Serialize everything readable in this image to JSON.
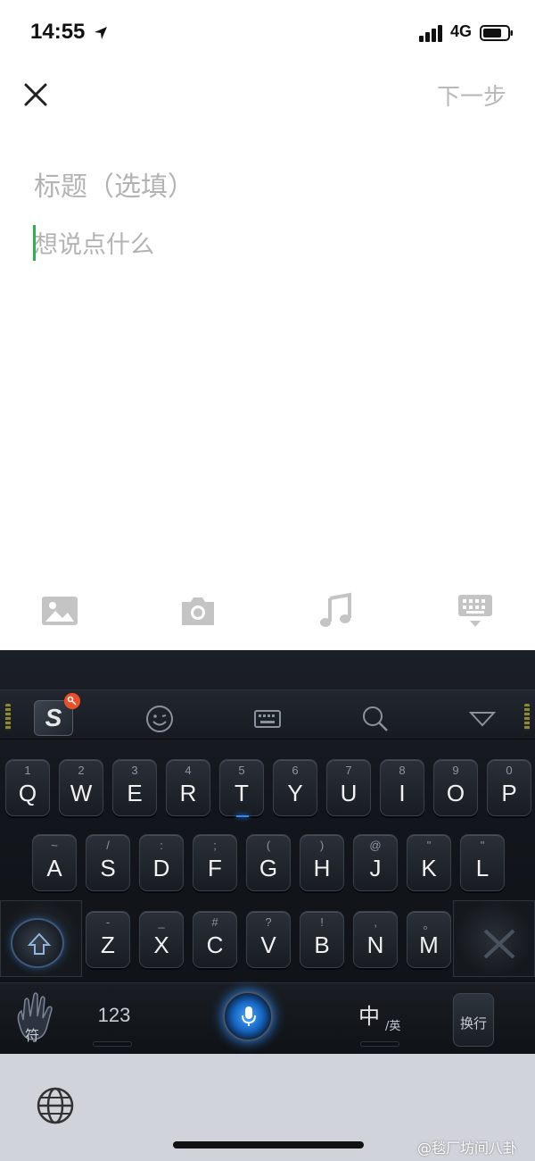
{
  "status_bar": {
    "time": "14:55",
    "network": "4G"
  },
  "nav": {
    "next_label": "下一步"
  },
  "editor": {
    "title_placeholder": "标题（选填）",
    "body_placeholder": "想说点什么"
  },
  "media_toolbar": {
    "icons": [
      "image-icon",
      "camera-icon",
      "music-icon",
      "keyboard-hide-icon"
    ]
  },
  "keyboard": {
    "theme_colors": {
      "accent": "#2f8cff",
      "key_bg": "#1f242b",
      "caret": "#2bb24c"
    },
    "row1": [
      {
        "main": "Q",
        "sub": "1"
      },
      {
        "main": "W",
        "sub": "2"
      },
      {
        "main": "E",
        "sub": "3"
      },
      {
        "main": "R",
        "sub": "4"
      },
      {
        "main": "T",
        "sub": "5"
      },
      {
        "main": "Y",
        "sub": "6"
      },
      {
        "main": "U",
        "sub": "7"
      },
      {
        "main": "I",
        "sub": "8"
      },
      {
        "main": "O",
        "sub": "9"
      },
      {
        "main": "P",
        "sub": "0"
      }
    ],
    "row2": [
      {
        "main": "A",
        "sub": "~"
      },
      {
        "main": "S",
        "sub": "/"
      },
      {
        "main": "D",
        "sub": ":"
      },
      {
        "main": "F",
        "sub": ";"
      },
      {
        "main": "G",
        "sub": "("
      },
      {
        "main": "H",
        "sub": ")"
      },
      {
        "main": "J",
        "sub": "@"
      },
      {
        "main": "K",
        "sub": "\""
      },
      {
        "main": "L",
        "sub": "\""
      }
    ],
    "row3": [
      {
        "main": "Z",
        "sub": "-"
      },
      {
        "main": "X",
        "sub": "_"
      },
      {
        "main": "C",
        "sub": "#"
      },
      {
        "main": "V",
        "sub": "?"
      },
      {
        "main": "B",
        "sub": "!"
      },
      {
        "main": "N",
        "sub": ","
      },
      {
        "main": "M",
        "sub": "。"
      }
    ],
    "symbol_label": "符",
    "num_label": "123",
    "lang_main": "中",
    "lang_sub": "/英",
    "enter_label": "换行",
    "logo_letter": "S"
  },
  "system_bar": {
    "watermark": "@毯厂坊间八卦"
  }
}
